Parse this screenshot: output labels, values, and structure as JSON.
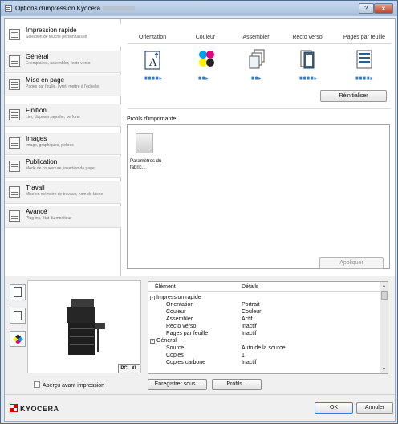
{
  "window": {
    "title": "Options d'impression Kyocera",
    "help_label": "?",
    "close_label": "x"
  },
  "sidebar": {
    "items": [
      {
        "title": "Impression rapide",
        "sub": "Sélection de touche personnalisée"
      },
      {
        "title": "Général",
        "sub": "Exemplaires, assembler, recto verso"
      },
      {
        "title": "Mise en page",
        "sub": "Pages par feuille, livret, mettre à l'échelle"
      },
      {
        "title": "Finition",
        "sub": "Lier, disposer, agrafer, perforer"
      },
      {
        "title": "Images",
        "sub": "Image, graphiques, polices"
      },
      {
        "title": "Publication",
        "sub": "Mode de couverture, insertion de page"
      },
      {
        "title": "Travail",
        "sub": "Mise en mémoire de travaux, nom de tâche"
      },
      {
        "title": "Avancé",
        "sub": "Plug-ins, état du moniteur"
      }
    ]
  },
  "quick": {
    "columns": [
      "Orientation",
      "Couleur",
      "Assembler",
      "Recto verso",
      "Pages par feuille"
    ],
    "reset_label": "Réinitialiser"
  },
  "profiles": {
    "label": "Profils d'imprimante:",
    "items": [
      {
        "label": "Paramètres du fabric..."
      }
    ],
    "apply_label": "Appliquer"
  },
  "printer": {
    "pdl": "PCL XL",
    "preview_label": "Aperçu avant impression"
  },
  "tree": {
    "col_element": "Élément",
    "col_details": "Détails",
    "rows": [
      {
        "element": "Impression rapide",
        "value": "",
        "group": true
      },
      {
        "element": "Orientation",
        "value": "Portrait",
        "group": false
      },
      {
        "element": "Couleur",
        "value": "Couleur",
        "group": false
      },
      {
        "element": "Assembler",
        "value": "Actif",
        "group": false
      },
      {
        "element": "Recto verso",
        "value": "Inactif",
        "group": false
      },
      {
        "element": "Pages par feuille",
        "value": "Inactif",
        "group": false
      },
      {
        "element": "Général",
        "value": "",
        "group": true
      },
      {
        "element": "Source",
        "value": "Auto de la source",
        "group": false
      },
      {
        "element": "Copies",
        "value": "1",
        "group": false
      },
      {
        "element": "Copies carbone",
        "value": "Inactif",
        "group": false
      }
    ]
  },
  "buttons": {
    "save": "Enregistrer sous...",
    "profiles": "Profils...",
    "ok": "OK",
    "cancel": "Annuler"
  },
  "brand": "KYOCERA",
  "colors": {
    "accent": "#2b7bd8",
    "brand": "#d40000"
  }
}
